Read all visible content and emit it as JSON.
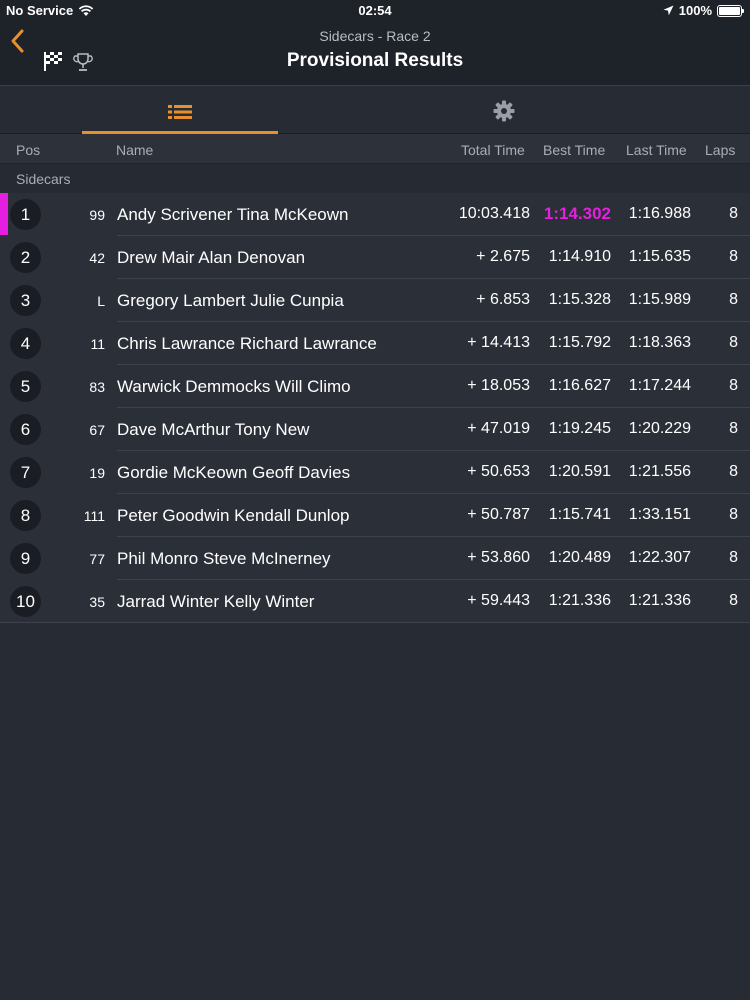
{
  "status_bar": {
    "carrier": "No Service",
    "time": "02:54",
    "battery": "100%"
  },
  "header": {
    "subtitle": "Sidecars - Race 2",
    "title": "Provisional Results"
  },
  "columns": {
    "pos": "Pos",
    "name": "Name",
    "total": "Total Time",
    "best": "Best Time",
    "last": "Last Time",
    "laps": "Laps"
  },
  "group_label": "Sidecars",
  "colors": {
    "accent": "#e8902e",
    "fastest": "#e61ee0",
    "leader_marker": "#e61ee0"
  },
  "rows": [
    {
      "pos": "1",
      "num": "99",
      "name": "Andy Scrivener Tina McKeown",
      "total": "10:03.418",
      "best": "1:14.302",
      "last": "1:16.988",
      "laps": "8",
      "fastest": true
    },
    {
      "pos": "2",
      "num": "42",
      "name": "Drew Mair Alan Denovan",
      "total": "+ 2.675",
      "best": "1:14.910",
      "last": "1:15.635",
      "laps": "8"
    },
    {
      "pos": "3",
      "num": "L",
      "name": "Gregory Lambert Julie Cunpia",
      "total": "+ 6.853",
      "best": "1:15.328",
      "last": "1:15.989",
      "laps": "8"
    },
    {
      "pos": "4",
      "num": "11",
      "name": "Chris Lawrance Richard Lawrance",
      "total": "+ 14.413",
      "best": "1:15.792",
      "last": "1:18.363",
      "laps": "8"
    },
    {
      "pos": "5",
      "num": "83",
      "name": "Warwick Demmocks Will Climo",
      "total": "+ 18.053",
      "best": "1:16.627",
      "last": "1:17.244",
      "laps": "8"
    },
    {
      "pos": "6",
      "num": "67",
      "name": "Dave McArthur Tony New",
      "total": "+ 47.019",
      "best": "1:19.245",
      "last": "1:20.229",
      "laps": "8"
    },
    {
      "pos": "7",
      "num": "19",
      "name": "Gordie McKeown Geoff Davies",
      "total": "+ 50.653",
      "best": "1:20.591",
      "last": "1:21.556",
      "laps": "8"
    },
    {
      "pos": "8",
      "num": "111",
      "name": "Peter Goodwin Kendall Dunlop",
      "total": "+ 50.787",
      "best": "1:15.741",
      "last": "1:33.151",
      "laps": "8"
    },
    {
      "pos": "9",
      "num": "77",
      "name": "Phil Monro Steve McInerney",
      "total": "+ 53.860",
      "best": "1:20.489",
      "last": "1:22.307",
      "laps": "8"
    },
    {
      "pos": "10",
      "num": "35",
      "name": "Jarrad Winter Kelly Winter",
      "total": "+ 59.443",
      "best": "1:21.336",
      "last": "1:21.336",
      "laps": "8"
    }
  ]
}
